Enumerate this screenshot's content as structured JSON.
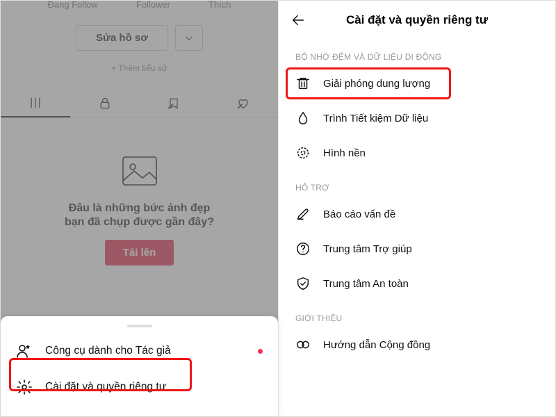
{
  "left": {
    "stats": {
      "following": "Đang Follow",
      "follower": "Follower",
      "likes": "Thích"
    },
    "edit_profile": "Sửa hồ sơ",
    "add_bio": "+ Thêm tiểu sử",
    "empty_title": "Đâu là những bức ảnh đẹp",
    "empty_sub": "bạn đã chụp được gần đây?",
    "upload": "Tải lên",
    "sheet": {
      "creator_tools": "Công cụ dành cho Tác giả",
      "settings": "Cài đặt và quyền riêng tư"
    }
  },
  "right": {
    "title": "Cài đặt và quyền riêng tư",
    "sections": {
      "cache_label": "BỘ NHỚ ĐỆM VÀ DỮ LIỆU DI ĐỘNG",
      "support_label": "HỖ TRỢ",
      "about_label": "GIỚI THIỆU"
    },
    "items": {
      "free_up": "Giải phóng dung lượng",
      "data_saver": "Trình Tiết kiệm Dữ liệu",
      "wallpaper": "Hình nền",
      "report": "Báo cáo vấn đề",
      "help_center": "Trung tâm Trợ giúp",
      "safety_center": "Trung tâm An toàn",
      "community_guidelines": "Hướng dẫn Cộng đồng"
    }
  }
}
